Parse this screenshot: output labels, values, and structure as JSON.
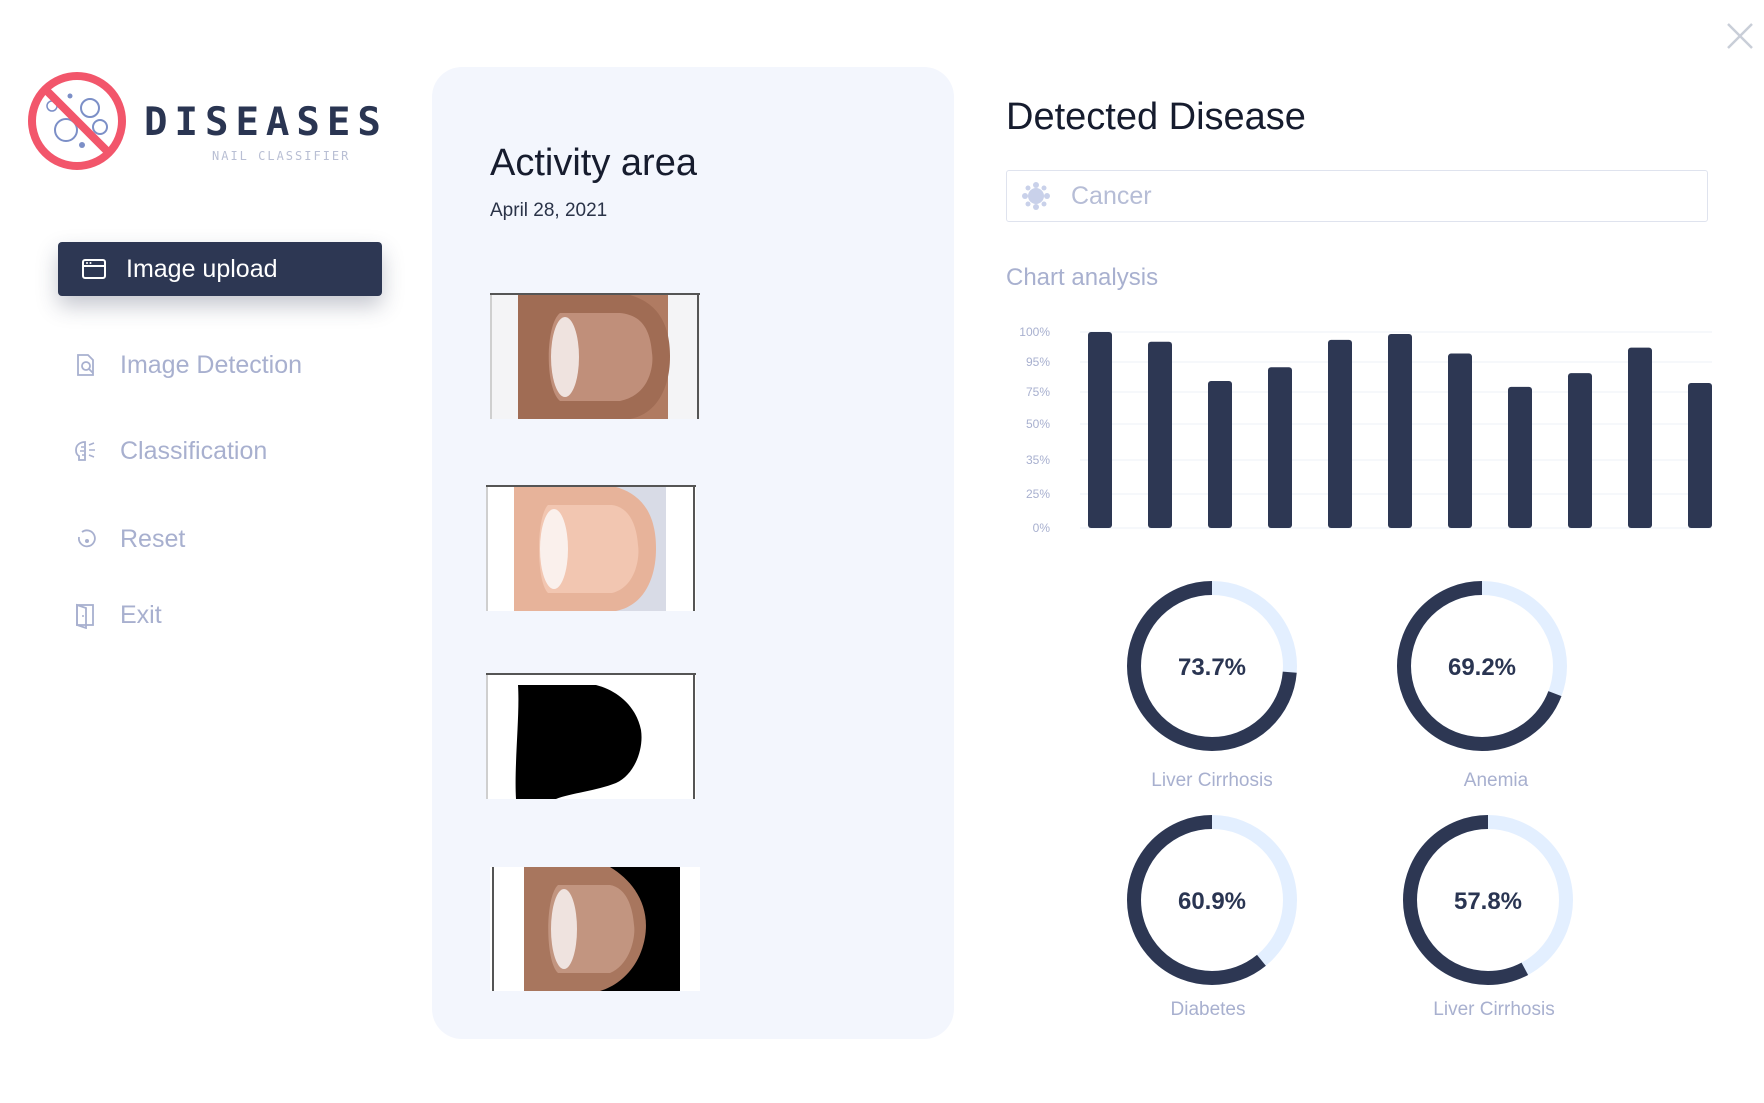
{
  "window": {
    "close_icon": "close-icon"
  },
  "brand": {
    "title": "DISEASES",
    "subtitle": "NAIL CLASSIFIER",
    "logo_icon": "virus-prohibited-icon"
  },
  "nav": {
    "items": [
      {
        "label": "Image upload",
        "icon": "window-icon",
        "active": true
      },
      {
        "label": "Image Detection",
        "icon": "detect-icon",
        "active": false
      },
      {
        "label": "Classification",
        "icon": "brain-icon",
        "active": false
      },
      {
        "label": "Reset",
        "icon": "reset-icon",
        "active": false
      },
      {
        "label": "Exit",
        "icon": "exit-door-icon",
        "active": false
      }
    ]
  },
  "activity": {
    "title": "Activity area",
    "date": "April 28, 2021",
    "images": [
      "nail-photo-original",
      "nail-photo-enhanced",
      "nail-mask-binary",
      "nail-segmented"
    ]
  },
  "detected": {
    "title": "Detected Disease",
    "value": "Cancer",
    "icon": "virus-icon"
  },
  "chart_section": {
    "title": "Chart analysis"
  },
  "chart_data": [
    {
      "type": "bar",
      "title": "Chart analysis",
      "y_tick_labels": [
        "0%",
        "25%",
        "35%",
        "50%",
        "75%",
        "95%",
        "100%"
      ],
      "values": [
        100,
        95,
        75,
        82,
        96,
        99,
        89,
        72,
        79,
        92,
        74
      ],
      "color": "#2d3753",
      "grid": true
    },
    {
      "type": "pie",
      "variant": "donut",
      "items": [
        {
          "label": "Liver Cirrhosis",
          "value": 73.7,
          "display": "73.7%"
        },
        {
          "label": "Anemia",
          "value": 69.2,
          "display": "69.2%"
        },
        {
          "label": "Diabetes",
          "value": 60.9,
          "display": "60.9%"
        },
        {
          "label": "Liver Cirrhosis",
          "value": 57.8,
          "display": "57.8%"
        }
      ],
      "fg_color": "#2d3753",
      "bg_color": "#e3efff"
    }
  ]
}
